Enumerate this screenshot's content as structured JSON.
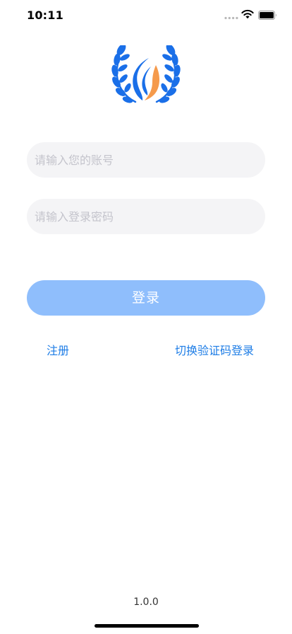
{
  "status_bar": {
    "time": "10:11"
  },
  "icons": {
    "logo": "laurel-flame-logo",
    "signal": "cellular-signal-icon",
    "wifi": "wifi-icon",
    "battery": "battery-icon"
  },
  "form": {
    "account_placeholder": "请输入您的账号",
    "account_value": "",
    "password_placeholder": "请输入登录密码",
    "password_value": ""
  },
  "actions": {
    "login_label": "登录",
    "register_label": "注册",
    "switch_label": "切换验证码登录"
  },
  "footer": {
    "version": "1.0.0"
  },
  "colors": {
    "brand_blue": "#1a6fe8",
    "brand_orange": "#f59a4c",
    "button": "#8fbefc",
    "link": "#1e7de6",
    "input_bg": "#f4f4f6"
  }
}
